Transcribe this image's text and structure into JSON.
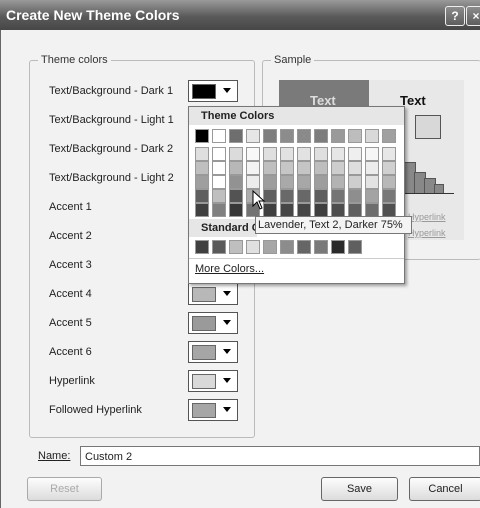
{
  "window": {
    "title": "Create New Theme Colors",
    "help_glyph": "?",
    "close_glyph": "×"
  },
  "theme_group": {
    "title": "Theme colors"
  },
  "rows": [
    {
      "label": "Text/Background - Dark 1",
      "color": "#000000",
      "icon": "chevron-down-icon"
    },
    {
      "label": "Text/Background - Light 1"
    },
    {
      "label": "Text/Background - Dark 2"
    },
    {
      "label": "Text/Background - Light 2"
    },
    {
      "label": "Accent 1"
    },
    {
      "label": "Accent 2"
    },
    {
      "label": "Accent 3"
    },
    {
      "label": "Accent 4",
      "color": "#b8b8b8",
      "icon": "chevron-down-icon"
    },
    {
      "label": "Accent 5",
      "color": "#9a9a9a",
      "icon": "chevron-down-icon"
    },
    {
      "label": "Accent 6",
      "color": "#a6a6a6",
      "icon": "chevron-down-icon"
    },
    {
      "label": "Hyperlink",
      "color": "#d9d9d9",
      "icon": "chevron-down-icon"
    },
    {
      "label": "Followed Hyperlink",
      "color": "#a6a6a6",
      "icon": "chevron-down-icon"
    }
  ],
  "sample": {
    "title": "Sample",
    "text_dark": "Text",
    "text_light": "Text",
    "link1": "Hyperlink",
    "link2": "Hyperlink"
  },
  "palette": {
    "theme_header": "Theme Colors",
    "theme_row": [
      "#000000",
      "#ffffff",
      "#6e6e6e",
      "#e6e6e6",
      "#7e7e7e",
      "#8c8c8c",
      "#8a8a8a",
      "#7d7d7d",
      "#9a9a9a",
      "#bdbdbd",
      "#d9d9d9",
      "#a0a0a0"
    ],
    "standard_header": "Standard Colors",
    "standard_row": [
      "#404040",
      "#5a5a5a",
      "#bfbfbf",
      "#e0e0e0",
      "#a6a6a6",
      "#8c8c8c",
      "#666666",
      "#7a7a7a",
      "#2a2a2a",
      "#5f5f5f"
    ],
    "more_colors": "More Colors...",
    "tooltip": "Lavender, Text 2, Darker 75%"
  },
  "name_field": {
    "label": "Name:",
    "value": "Custom 2"
  },
  "buttons": {
    "reset": "Reset",
    "save": "Save",
    "cancel": "Cancel"
  }
}
